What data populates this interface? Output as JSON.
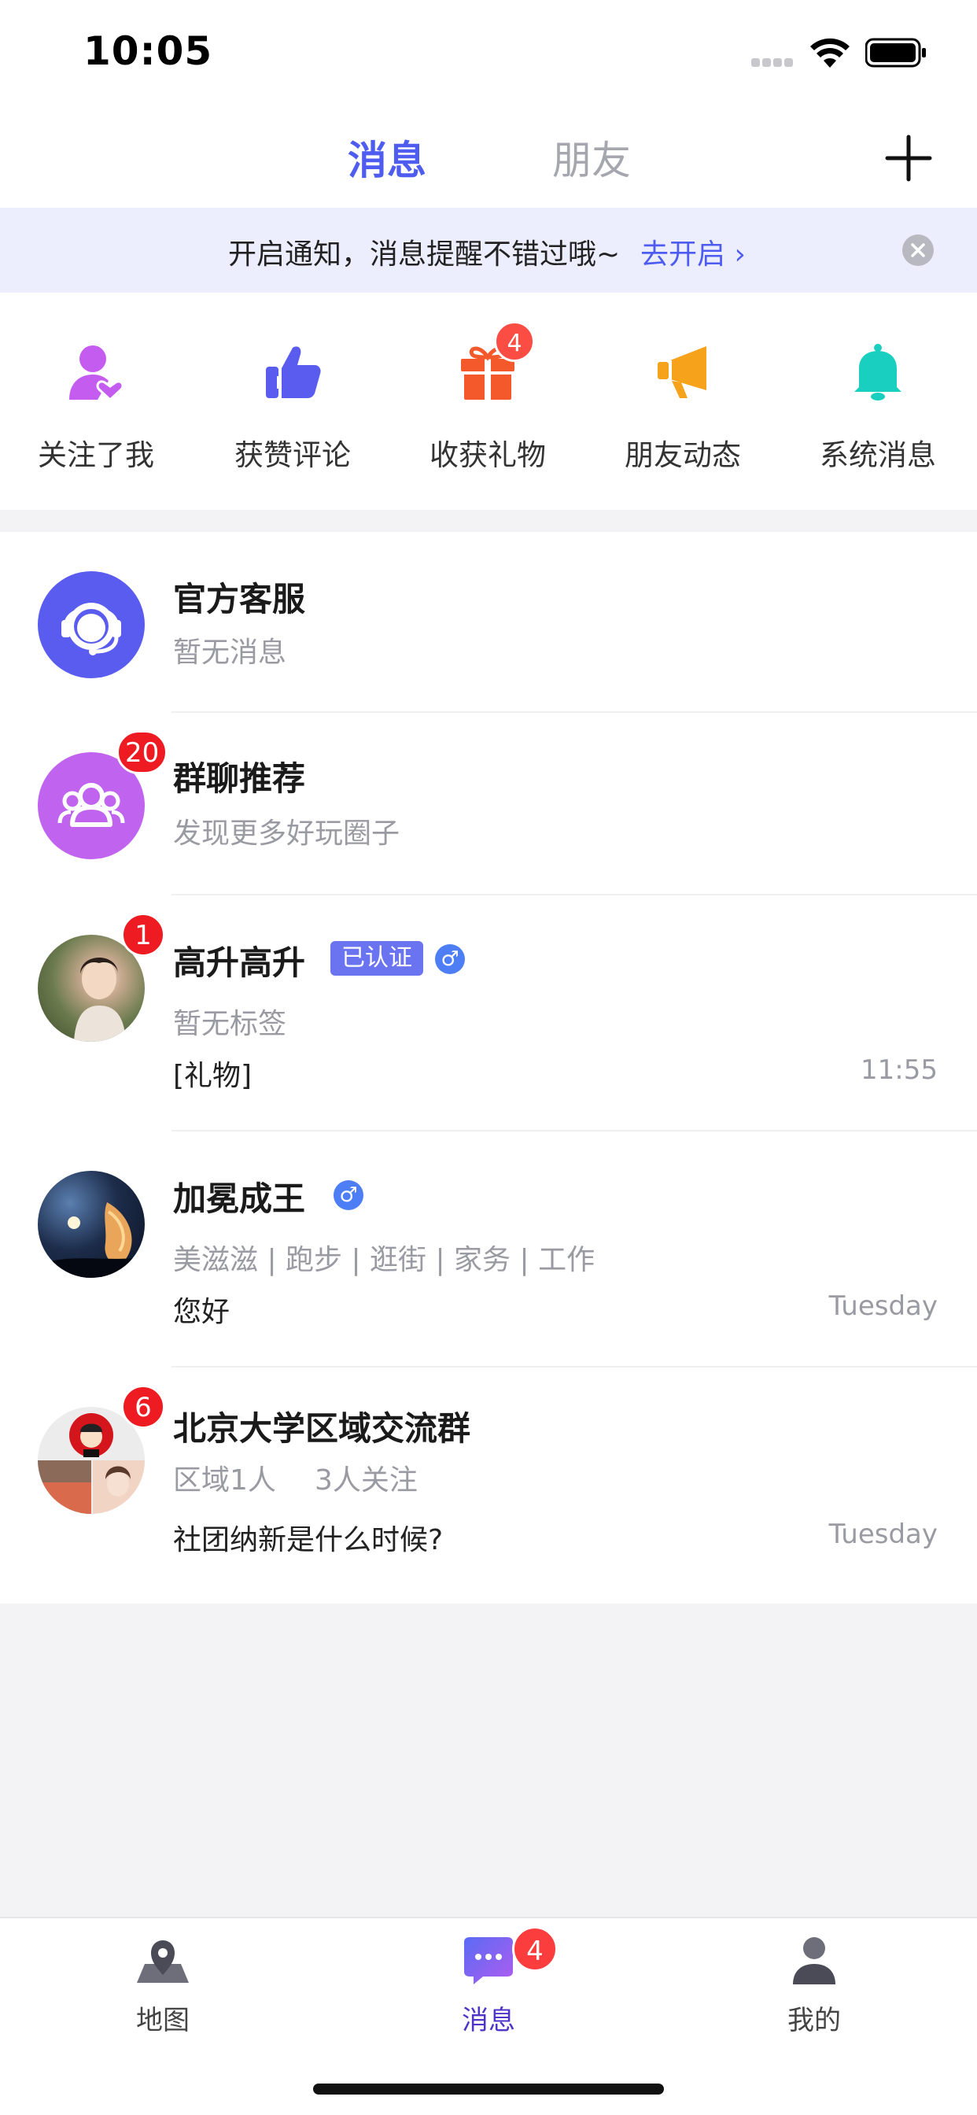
{
  "status_bar": {
    "time": "10:05"
  },
  "header": {
    "tabs": [
      {
        "label": "消息",
        "active": true
      },
      {
        "label": "朋友",
        "active": false
      }
    ]
  },
  "notice": {
    "text": "开启通知，消息提醒不错过哦~",
    "link": "去开启 ›"
  },
  "quick_actions": [
    {
      "label": "关注了我",
      "icon": "user-heart-icon",
      "color": "#c45cf0",
      "badge": ""
    },
    {
      "label": "获赞评论",
      "icon": "thumbs-up-icon",
      "color": "#5a5cf0",
      "badge": ""
    },
    {
      "label": "收获礼物",
      "icon": "gift-icon",
      "color": "#f4592b",
      "badge": "4"
    },
    {
      "label": "朋友动态",
      "icon": "megaphone-icon",
      "color": "#f7a21b",
      "badge": ""
    },
    {
      "label": "系统消息",
      "icon": "bell-icon",
      "color": "#19d0c0",
      "badge": ""
    }
  ],
  "conversations": [
    {
      "title": "官方客服",
      "sub": "暂无消息",
      "badge": "",
      "icon": "headset-icon",
      "avatar_color": "#5a5cf0"
    },
    {
      "title": "群聊推荐",
      "sub": "发现更多好玩圈子",
      "badge": "20",
      "icon": "group-icon",
      "avatar_color": "#c064f0"
    },
    {
      "title": "高升高升",
      "verified": "已认证",
      "gender": "♂",
      "sub": "暂无标签",
      "message": "[礼物]",
      "time": "11:55",
      "badge": "1"
    },
    {
      "title": "加冕成王",
      "gender": "♂",
      "sub": "美滋滋 | 跑步 | 逛街 | 家务 | 工作",
      "message": "您好",
      "time": "Tuesday",
      "badge": ""
    },
    {
      "title": "北京大学区域交流群",
      "sub_members": "区域1人",
      "sub_followers": "3人关注",
      "message": "社团纳新是什么时候?",
      "time": "Tuesday",
      "badge": "6"
    }
  ],
  "bottom_nav": [
    {
      "label": "地图",
      "icon": "map-icon",
      "active": false,
      "badge": ""
    },
    {
      "label": "消息",
      "icon": "chat-icon",
      "active": true,
      "badge": "4"
    },
    {
      "label": "我的",
      "icon": "profile-icon",
      "active": false,
      "badge": ""
    }
  ]
}
